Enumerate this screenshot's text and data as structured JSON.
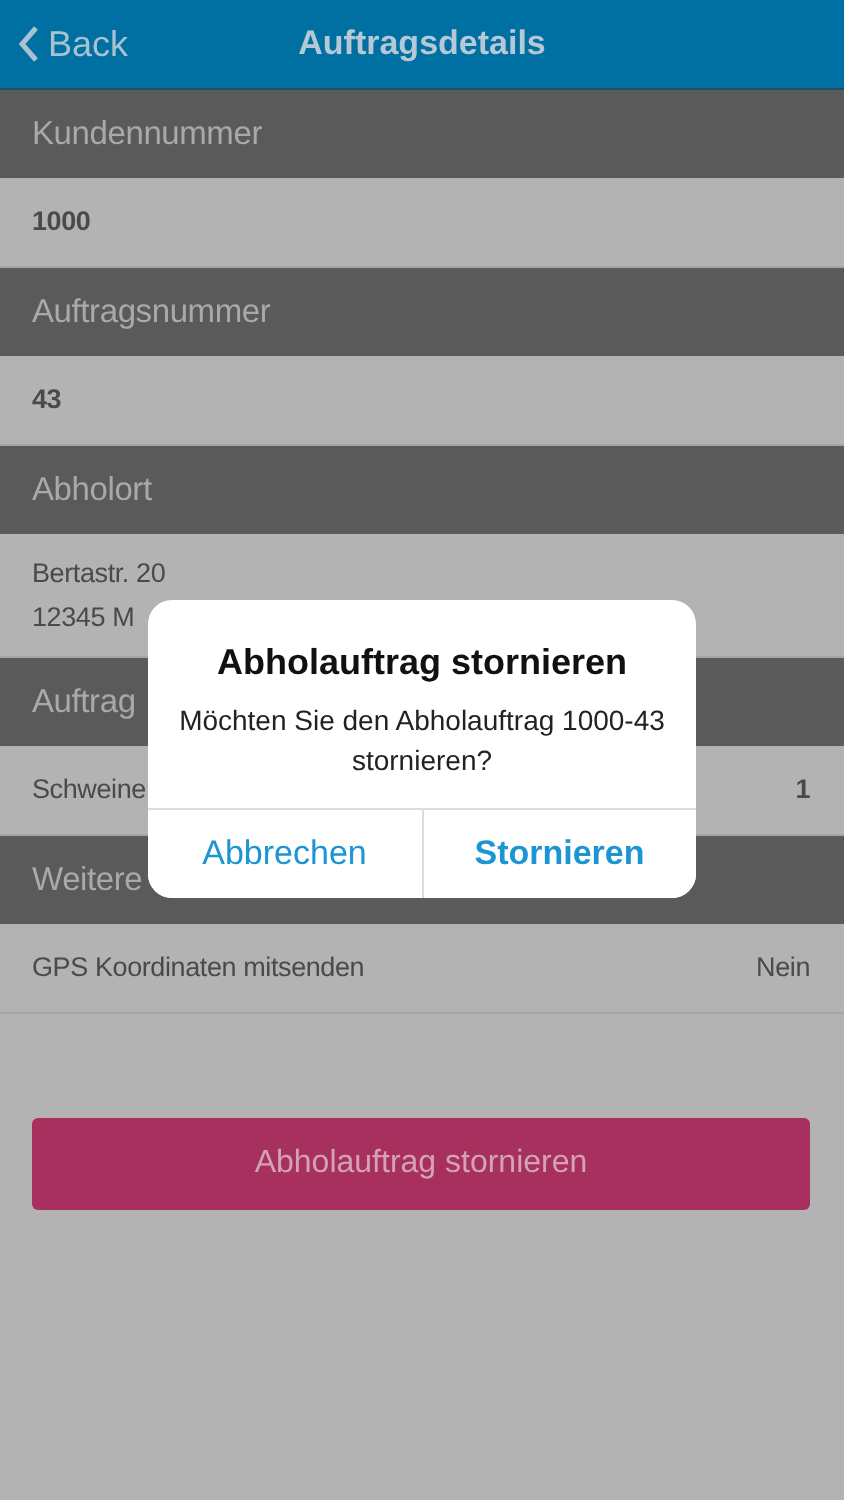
{
  "header": {
    "back": "Back",
    "title": "Auftragsdetails"
  },
  "sections": [
    {
      "title": "Kundennummer",
      "row": {
        "kind": "value",
        "lines": [
          "1000"
        ]
      }
    },
    {
      "title": "Auftragsnummer",
      "row": {
        "kind": "value",
        "lines": [
          "43"
        ]
      }
    },
    {
      "title": "Abholort",
      "row": {
        "kind": "address",
        "lines": [
          "Bertastr. 20",
          "12345 M"
        ]
      }
    },
    {
      "title": "Auftrag",
      "row": {
        "kind": "pair",
        "label": "Schweine",
        "value": "1"
      }
    },
    {
      "title": "Weitere",
      "row": {
        "kind": "pair",
        "label": "GPS Koordinaten mitsenden",
        "value": "Nein"
      }
    }
  ],
  "action_button": "Abholauftrag stornieren",
  "dialog": {
    "title": "Abholauftrag stornieren",
    "message": "Möchten Sie den Abholauftrag 1000-43 stornieren?",
    "buttons": [
      {
        "label": "Abbrechen",
        "primary": false
      },
      {
        "label": "Stornieren",
        "primary": true
      }
    ]
  }
}
